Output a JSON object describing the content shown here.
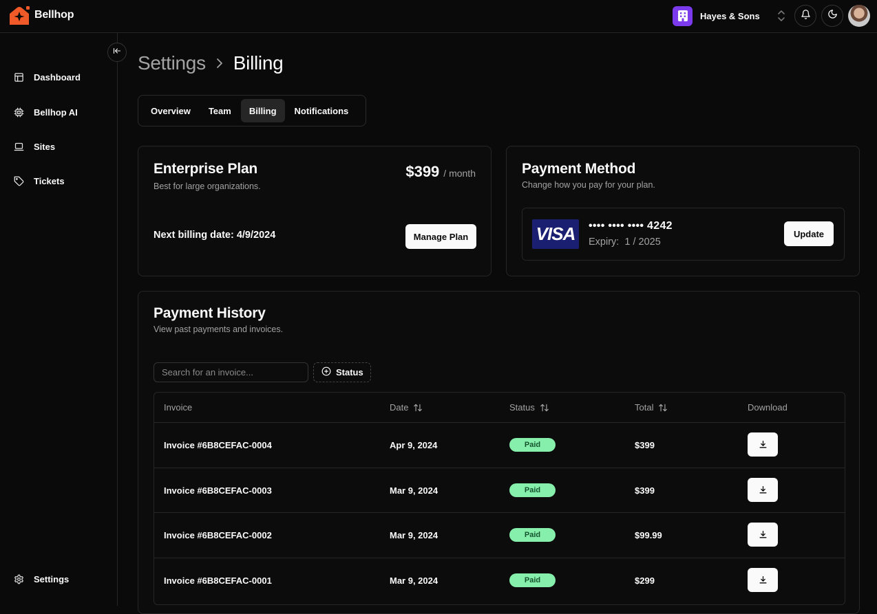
{
  "app": {
    "name": "Bellhop"
  },
  "org": {
    "name": "Hayes & Sons"
  },
  "sidebar": {
    "items": [
      {
        "label": "Dashboard",
        "icon": "layout-icon"
      },
      {
        "label": "Bellhop AI",
        "icon": "cpu-icon"
      },
      {
        "label": "Sites",
        "icon": "laptop-icon"
      },
      {
        "label": "Tickets",
        "icon": "tag-icon"
      }
    ],
    "settings_label": "Settings"
  },
  "breadcrumb": {
    "parent": "Settings",
    "current": "Billing"
  },
  "tabs": [
    {
      "label": "Overview",
      "active": false
    },
    {
      "label": "Team",
      "active": false
    },
    {
      "label": "Billing",
      "active": true
    },
    {
      "label": "Notifications",
      "active": false
    }
  ],
  "plan": {
    "title": "Enterprise Plan",
    "subtitle": "Best for large organizations.",
    "price": "$399",
    "period": "/ month",
    "next_billing": "Next billing date: 4/9/2024",
    "manage_label": "Manage Plan"
  },
  "payment_method": {
    "title": "Payment Method",
    "subtitle": "Change how you pay for your plan.",
    "card_brand": "VISA",
    "card_number": "•••• •••• •••• 4242",
    "expiry": "Expiry:  1 / 2025",
    "update_label": "Update"
  },
  "history": {
    "title": "Payment History",
    "subtitle": "View past payments and invoices.",
    "search_placeholder": "Search for an invoice...",
    "status_filter_label": "Status",
    "columns": [
      "Invoice",
      "Date",
      "Status",
      "Total",
      "Download"
    ],
    "rows": [
      {
        "invoice": "Invoice #6B8CEFAC-0004",
        "date": "Apr 9, 2024",
        "status": "Paid",
        "total": "$399"
      },
      {
        "invoice": "Invoice #6B8CEFAC-0003",
        "date": "Mar 9, 2024",
        "status": "Paid",
        "total": "$399"
      },
      {
        "invoice": "Invoice #6B8CEFAC-0002",
        "date": "Mar 9, 2024",
        "status": "Paid",
        "total": "$99.99"
      },
      {
        "invoice": "Invoice #6B8CEFAC-0001",
        "date": "Mar 9, 2024",
        "status": "Paid",
        "total": "$299"
      }
    ]
  },
  "colors": {
    "brand": "#f05a28",
    "org_avatar": "#7c3aed",
    "paid_badge": "#86efac",
    "visa_blue": "#1a1f71"
  }
}
